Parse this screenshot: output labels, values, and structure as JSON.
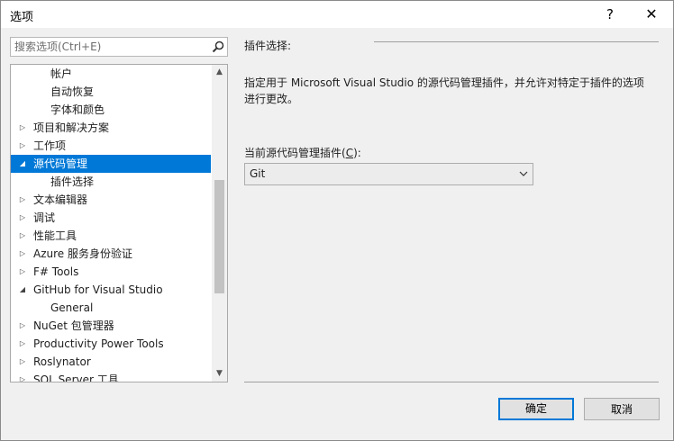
{
  "window": {
    "title": "选项",
    "help_label": "?",
    "close_label": "✕"
  },
  "search": {
    "placeholder": "搜索选项(Ctrl+E)",
    "value": ""
  },
  "tree": {
    "items": [
      {
        "label": "帐户",
        "level": 1,
        "arrow": ""
      },
      {
        "label": "自动恢复",
        "level": 1,
        "arrow": ""
      },
      {
        "label": "字体和颜色",
        "level": 1,
        "arrow": ""
      },
      {
        "label": "项目和解决方案",
        "level": 0,
        "arrow": "▷"
      },
      {
        "label": "工作项",
        "level": 0,
        "arrow": "▷"
      },
      {
        "label": "源代码管理",
        "level": 0,
        "arrow": "◢",
        "selected": true
      },
      {
        "label": "插件选择",
        "level": 1,
        "arrow": ""
      },
      {
        "label": "文本编辑器",
        "level": 0,
        "arrow": "▷"
      },
      {
        "label": "调试",
        "level": 0,
        "arrow": "▷"
      },
      {
        "label": "性能工具",
        "level": 0,
        "arrow": "▷"
      },
      {
        "label": "Azure 服务身份验证",
        "level": 0,
        "arrow": "▷"
      },
      {
        "label": "F# Tools",
        "level": 0,
        "arrow": "▷"
      },
      {
        "label": "GitHub for Visual Studio",
        "level": 0,
        "arrow": "◢"
      },
      {
        "label": "General",
        "level": 1,
        "arrow": ""
      },
      {
        "label": "NuGet 包管理器",
        "level": 0,
        "arrow": "▷"
      },
      {
        "label": "Productivity Power Tools",
        "level": 0,
        "arrow": "▷"
      },
      {
        "label": "Roslynator",
        "level": 0,
        "arrow": "▷"
      },
      {
        "label": "SQL Server 工具",
        "level": 0,
        "arrow": "▷"
      }
    ],
    "scroll_up": "▲",
    "scroll_down": "▼"
  },
  "content": {
    "section_header": "插件选择:",
    "description": "指定用于 Microsoft Visual Studio 的源代码管理插件，并允许对特定于插件的选项进行更改。",
    "plugin_label_prefix": "当前源代码管理插件(",
    "plugin_label_accel": "C",
    "plugin_label_suffix": "):",
    "plugin_value": "Git"
  },
  "buttons": {
    "ok": "确定",
    "cancel": "取消"
  }
}
